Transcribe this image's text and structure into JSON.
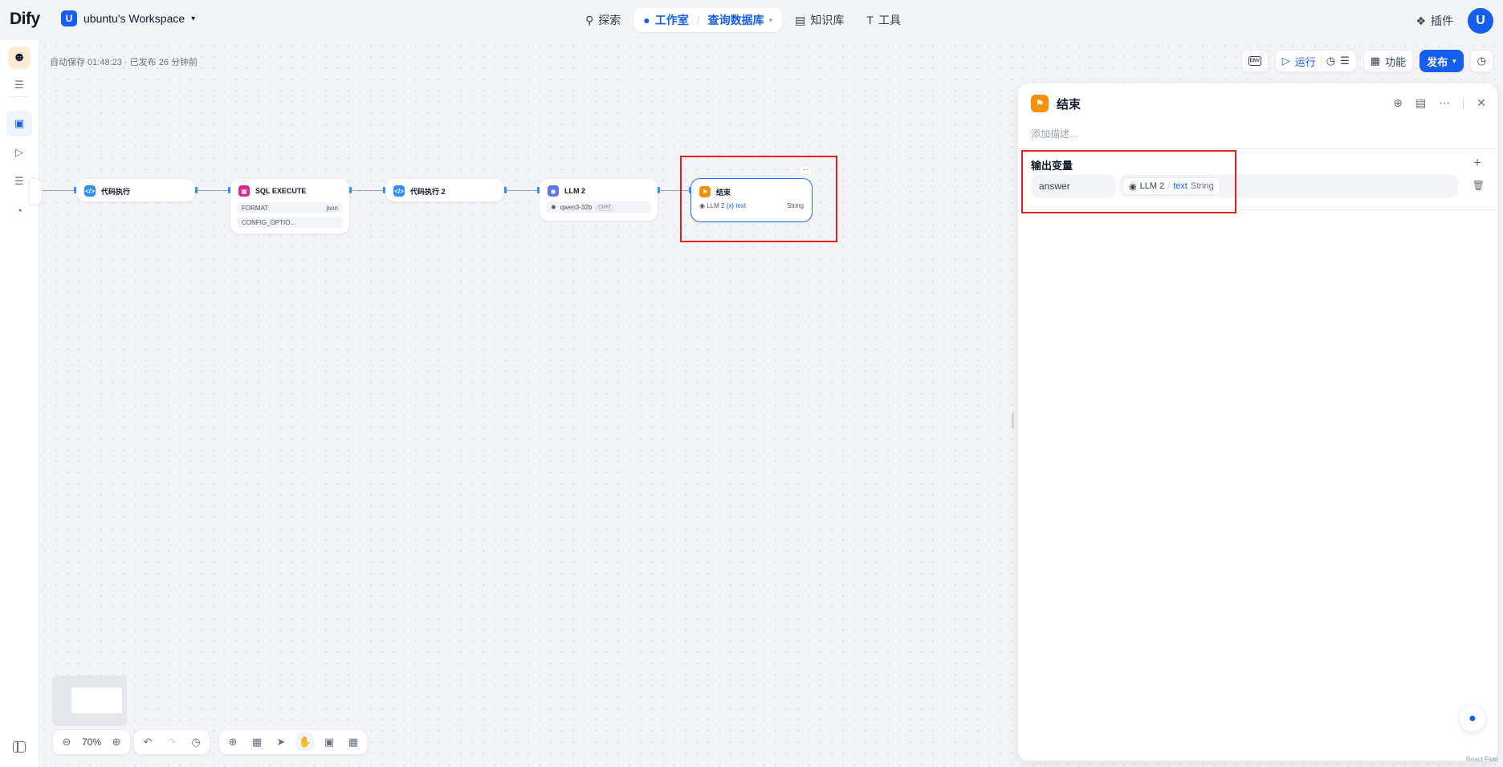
{
  "brand": {
    "logo_text": "Dify"
  },
  "workspace": {
    "avatar_letter": "U",
    "name": "ubuntu's Workspace"
  },
  "nav": {
    "explore": "探索",
    "studio": "工作室",
    "app_name": "查询数据库",
    "knowledge": "知识库",
    "tools": "工具"
  },
  "top_right": {
    "plugins": "插件",
    "user_letter": "U"
  },
  "canvas": {
    "autosave": "自动保存 01:48:23 · 已发布 26 分钟前",
    "toolbar": {
      "env": "ENV",
      "run": "运行",
      "features": "功能",
      "publish": "发布"
    },
    "zoom": "70%"
  },
  "nodes": {
    "code1": {
      "title": "代码执行"
    },
    "sql": {
      "title": "SQL EXECUTE",
      "rows": [
        {
          "key": "FORMAT",
          "value": "json"
        },
        {
          "key": "CONFIG_OPTIO...",
          "value": ""
        }
      ]
    },
    "code2": {
      "title": "代码执行 2"
    },
    "llm2": {
      "title": "LLM 2",
      "model": "qwen3-32b",
      "mode": "CHAT"
    },
    "end": {
      "title": "结束",
      "source": "LLM 2",
      "var": "{x} text",
      "type": "String"
    }
  },
  "panel": {
    "title": "结束",
    "description_placeholder": "添加描述...",
    "section_title": "输出变量",
    "variable": {
      "name": "answer",
      "node": "LLM 2",
      "field": "text",
      "type": "String"
    }
  },
  "footer": {
    "mark": "React Flow"
  },
  "colors": {
    "accent": "#155eef",
    "highlight": "#e0211d",
    "end_node": "#f79009"
  }
}
